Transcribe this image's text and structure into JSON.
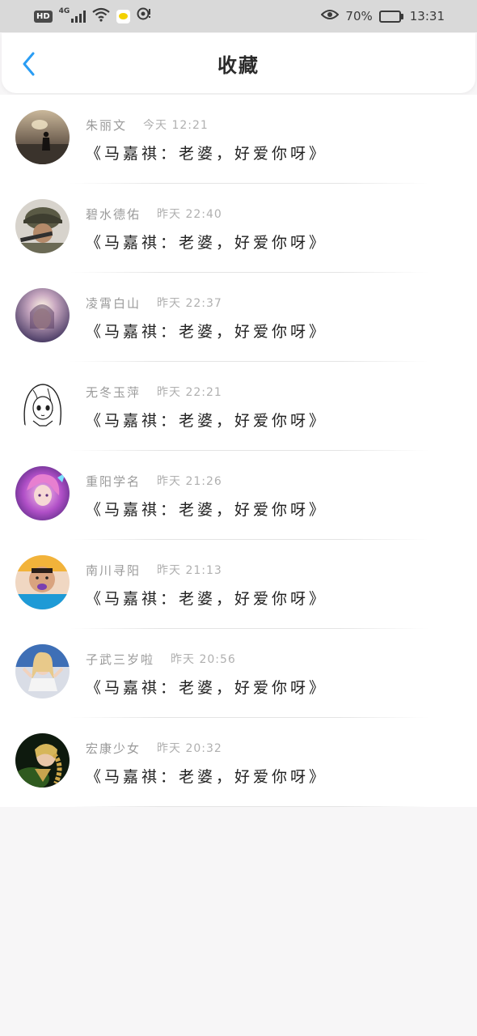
{
  "status_bar": {
    "hd": "HD",
    "network": "4G",
    "battery_percent": "70%",
    "battery_level": 0.7,
    "time": "13:31",
    "icons": [
      "hd-badge",
      "signal-icon",
      "wifi-icon",
      "chat-app-icon",
      "hotspot-icon",
      "eye-icon",
      "battery-icon"
    ]
  },
  "header": {
    "title": "收藏",
    "back_icon": "chevron-left-icon",
    "accent_color": "#2a9df4"
  },
  "favorites": [
    {
      "user": "朱丽文",
      "time": "今天 12:21",
      "content": "《马嘉祺：老婆，好爱你呀》",
      "avatar": "silhouette-sunset-avatar"
    },
    {
      "user": "碧水德佑",
      "time": "昨天 22:40",
      "content": "《马嘉祺：老婆，好爱你呀》",
      "avatar": "soldier-helmet-avatar"
    },
    {
      "user": "凌霄白山",
      "time": "昨天 22:37",
      "content": "《马嘉祺：老婆，好爱你呀》",
      "avatar": "light-portrait-avatar"
    },
    {
      "user": "无冬玉萍",
      "time": "昨天 22:21",
      "content": "《马嘉祺：老婆，好爱你呀》",
      "avatar": "anime-sketch-girl-avatar"
    },
    {
      "user": "重阳学名",
      "time": "昨天 21:26",
      "content": "《马嘉祺：老婆，好爱你呀》",
      "avatar": "fantasy-pink-hair-avatar"
    },
    {
      "user": "南川寻阳",
      "time": "昨天 21:13",
      "content": "《马嘉祺：老婆，好爱你呀》",
      "avatar": "boy-whistle-avatar"
    },
    {
      "user": "子武三岁啦",
      "time": "昨天 20:56",
      "content": "《马嘉祺：老婆，好爱你呀》",
      "avatar": "blonde-girl-avatar"
    },
    {
      "user": "宏康少女",
      "time": "昨天 20:32",
      "content": "《马嘉祺：老婆，好爱你呀》",
      "avatar": "braided-hair-avatar"
    }
  ]
}
